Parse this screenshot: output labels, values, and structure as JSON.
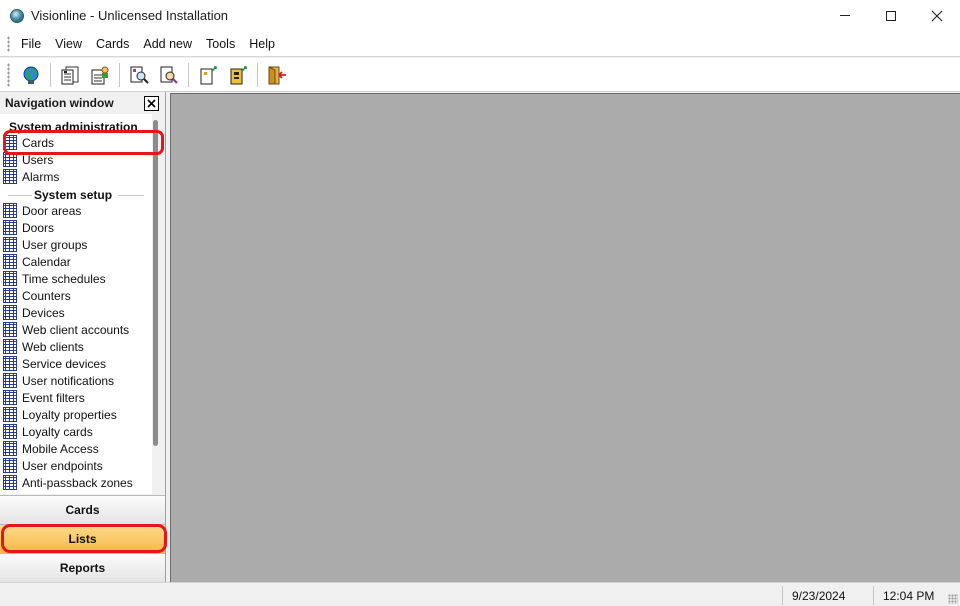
{
  "window": {
    "title": "Visionline - Unlicensed Installation",
    "controls": [
      "minimize",
      "maximize",
      "close"
    ]
  },
  "menu": [
    "File",
    "View",
    "Cards",
    "Add new",
    "Tools",
    "Help"
  ],
  "toolbar": {
    "buttons": [
      "globe-icon",
      "cards-list-icon",
      "user-card-icon",
      "find-user-icon",
      "search-card-icon",
      "new-card-icon",
      "encode-card-icon",
      "exit-door-icon"
    ]
  },
  "nav": {
    "header": "Navigation window",
    "close_label": "x",
    "section_admin": "System administration",
    "admin_items": [
      "Cards",
      "Users",
      "Alarms"
    ],
    "section_setup": "System setup",
    "setup_items": [
      "Door areas",
      "Doors",
      "User groups",
      "Calendar",
      "Time schedules",
      "Counters",
      "Devices",
      "Web client accounts",
      "Web clients",
      "Service devices",
      "User notifications",
      "Event filters",
      "Loyalty properties",
      "Loyalty cards",
      "Mobile Access",
      "User endpoints",
      "Anti-passback zones"
    ],
    "bottom_buttons": [
      "Cards",
      "Lists",
      "Reports"
    ],
    "active_bottom": "Lists"
  },
  "status": {
    "date": "9/23/2024",
    "time": "12:04 PM"
  },
  "colors": {
    "highlight_ring": "#e8141c",
    "active_tab": "#f3b94a",
    "client_area": "#ababab"
  }
}
